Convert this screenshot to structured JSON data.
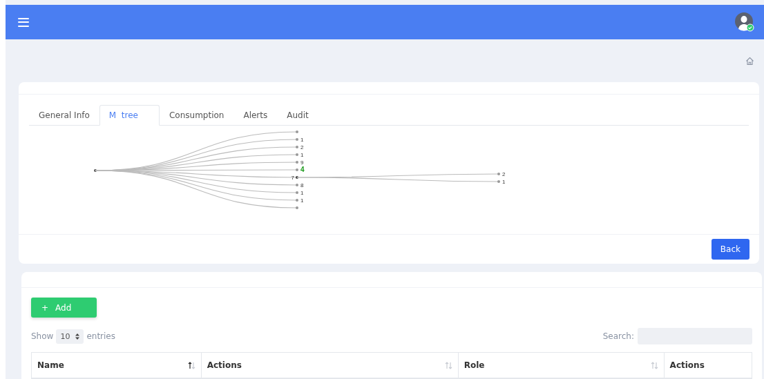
{
  "tabs": [
    {
      "label": "General Info",
      "selected": false
    },
    {
      "label": "M  tree",
      "selected": true
    },
    {
      "label": "Consumption",
      "selected": false
    },
    {
      "label": "Alerts",
      "selected": false
    },
    {
      "label": "Audit",
      "selected": false
    }
  ],
  "tree": {
    "children": [
      {
        "kind": "node"
      },
      {
        "kind": "node",
        "label": "1"
      },
      {
        "kind": "node",
        "label": "2"
      },
      {
        "kind": "node",
        "label": "1"
      },
      {
        "kind": "node",
        "label": "9"
      },
      {
        "kind": "node",
        "label": "4",
        "highlighted": true
      },
      {
        "kind": "node",
        "label": "7",
        "children": [
          {
            "kind": "node",
            "label": "2"
          },
          {
            "kind": "node",
            "label": "1"
          }
        ]
      },
      {
        "kind": "node",
        "label": "8"
      },
      {
        "kind": "node",
        "label": "1"
      },
      {
        "kind": "node",
        "label": "1"
      },
      {
        "kind": "node"
      }
    ]
  },
  "back_button": "Back",
  "add_button": {
    "icon": "+",
    "label": "Add"
  },
  "length": {
    "show": "Show",
    "value": "10",
    "entries": "entries"
  },
  "search": {
    "label": "Search:"
  },
  "table": {
    "columns": [
      {
        "label": "Name",
        "sortable": true,
        "sorted": true
      },
      {
        "label": "Actions",
        "sortable": true,
        "sorted": false
      },
      {
        "label": "Role",
        "sortable": true,
        "sorted": false
      },
      {
        "label": "Actions",
        "sortable": false
      }
    ]
  }
}
